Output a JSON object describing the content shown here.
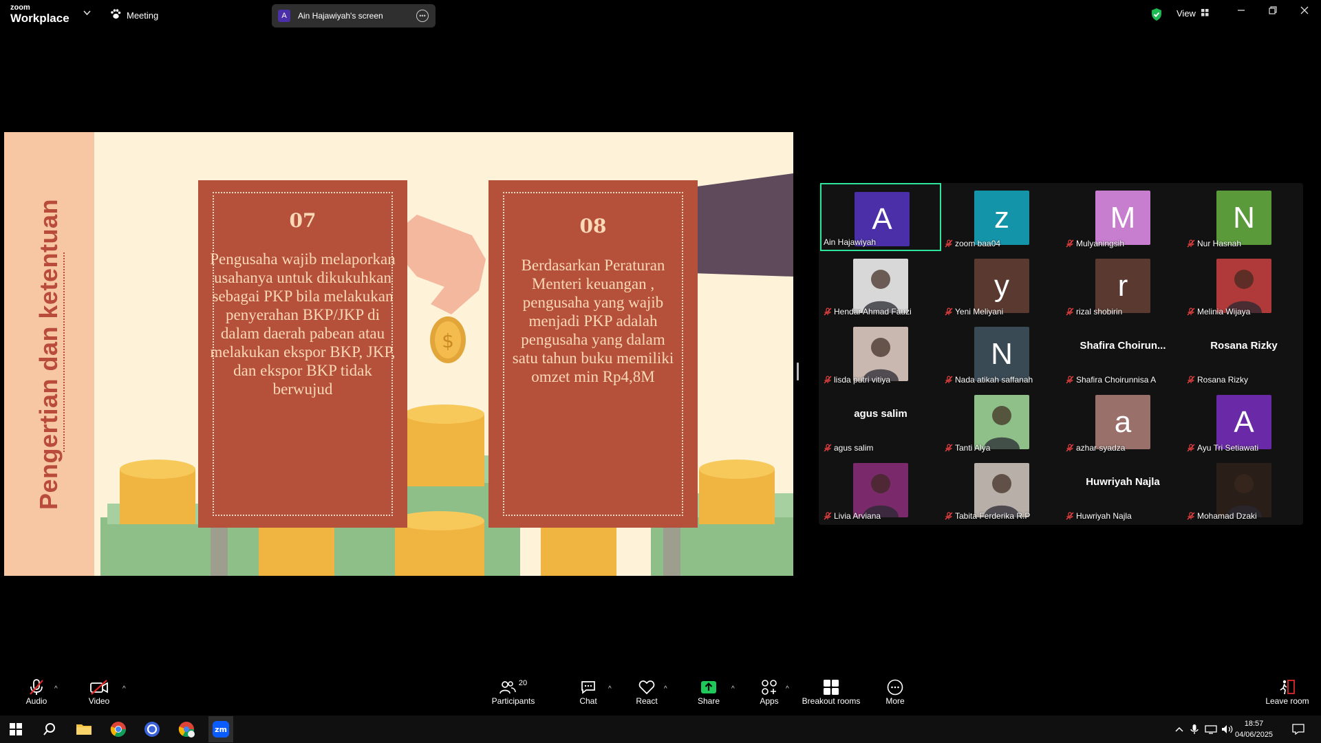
{
  "app": {
    "logo_top": "zoom",
    "logo_bottom": "Workplace",
    "meeting_label": "Meeting"
  },
  "screen_share": {
    "avatar_letter": "A",
    "label": "Ain Hajawiyah's screen"
  },
  "topright": {
    "view_label": "View"
  },
  "slide": {
    "side_title": "Pengertian dan ketentuan",
    "card1": {
      "number": "07",
      "text": "Pengusaha wajib melaporkan usahanya untuk dikukuhkan sebagai PKP bila melakukan penyerahan BKP/JKP di dalam daerah pabean atau melakukan ekspor BKP, JKP, dan ekspor BKP tidak berwujud"
    },
    "card2": {
      "number": "08",
      "text": "Berdasarkan Peraturan Menteri keuangan , pengusaha yang wajib menjadi PKP adalah pengusaha yang dalam satu tahun buku memiliki omzet min Rp4,8M"
    }
  },
  "participants": [
    {
      "name": "Ain Hajawiyah",
      "letter": "A",
      "color": "#4a2fa8",
      "muted": false,
      "active": true
    },
    {
      "name": "zoom baa04",
      "letter": "z",
      "color": "#1494a8",
      "muted": true
    },
    {
      "name": "Mulyaningsih",
      "letter": "M",
      "color": "#c77ecf",
      "muted": true
    },
    {
      "name": "Nur Hasnah",
      "letter": "N",
      "color": "#5a9a3a",
      "muted": true
    },
    {
      "name": "Hendar Ahmad Fauzi",
      "photo": true,
      "muted": true
    },
    {
      "name": "Yeni Meliyani",
      "letter": "y",
      "color": "#5a3a30",
      "muted": true
    },
    {
      "name": "rizal shobirin",
      "letter": "r",
      "color": "#5a3a30",
      "muted": true
    },
    {
      "name": "Melinia Wijaya",
      "photo": true,
      "muted": true
    },
    {
      "name": "lisda putri vitiya",
      "photo": true,
      "muted": true
    },
    {
      "name": "Nada atikah saffanah",
      "letter": "N",
      "color": "#3a4a55",
      "muted": true
    },
    {
      "name": "Shafira Choirunnisa A",
      "display": "Shafira  Choirun...",
      "muted": true
    },
    {
      "name": "Rosana Rizky",
      "display": "Rosana Rizky",
      "muted": true
    },
    {
      "name": "agus salim",
      "display": "agus salim",
      "muted": true
    },
    {
      "name": "Tanti Alya",
      "photo": true,
      "muted": true
    },
    {
      "name": "azhar syadza",
      "letter": "a",
      "color": "#9a706a",
      "muted": true
    },
    {
      "name": "Ayu Tri Setiawati",
      "letter": "A",
      "color": "#6a2aa8",
      "muted": true
    },
    {
      "name": "Livia Arviana",
      "photo": true,
      "muted": true
    },
    {
      "name": "Tabita Ferderika R.P",
      "photo": true,
      "muted": true
    },
    {
      "name": "Huwriyah Najla",
      "display": "Huwriyah Najla",
      "muted": true
    },
    {
      "name": "Mohamad Dzaki",
      "photo": true,
      "muted": true
    }
  ],
  "toolbar": {
    "audio": "Audio",
    "video": "Video",
    "participants": "Participants",
    "participants_count": "20",
    "chat": "Chat",
    "react": "React",
    "share": "Share",
    "apps": "Apps",
    "breakout": "Breakout rooms",
    "more": "More",
    "leave": "Leave room"
  },
  "taskbar": {
    "time": "18:57",
    "date": "04/06/2025"
  },
  "colors": {
    "accent_green": "#2ee59d",
    "share_green": "#1ec95a",
    "leave_red": "#e02828"
  }
}
